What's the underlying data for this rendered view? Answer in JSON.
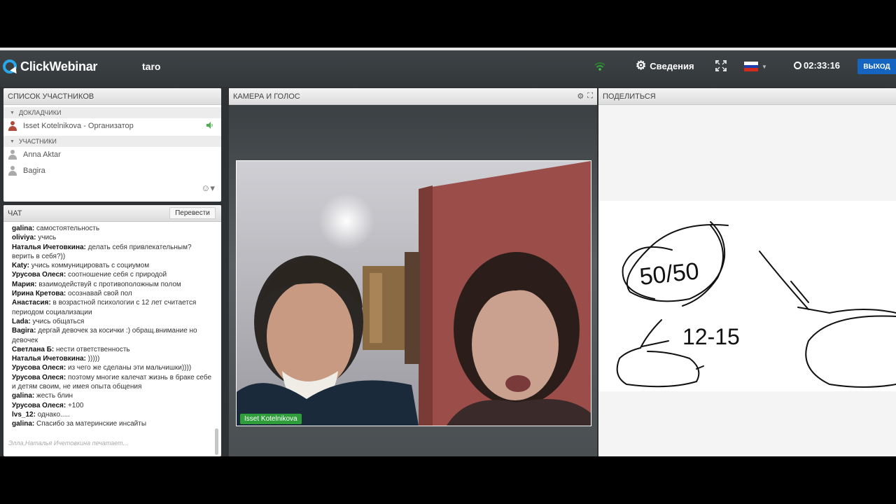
{
  "app": {
    "logo_text": "ClickWebinar",
    "room_name": "taro"
  },
  "header": {
    "info_label": "Сведения",
    "timer": "02:33:16",
    "exit_label": "ВЫХОД",
    "flag": "ru",
    "colors": {
      "accent": "#1565c0",
      "brand": "#2aa7e8"
    }
  },
  "participants": {
    "title": "СПИСОК УЧАСТНИКОВ",
    "speakers_label": "ДОКЛАДЧИКИ",
    "speakers": [
      {
        "name": "Isset Kotelnikova - Организатор"
      }
    ],
    "attendees_label": "УЧАСТНИКИ",
    "attendees": [
      {
        "name": "Anna Aktar"
      },
      {
        "name": "Bagira"
      }
    ]
  },
  "chat": {
    "title": "ЧАТ",
    "translate_label": "Перевести",
    "messages": [
      {
        "author": "galina:",
        "text": "самостоятельность"
      },
      {
        "author": "oliviya:",
        "text": "учись"
      },
      {
        "author": "Наталья Ичетовкина:",
        "text": "делать себя привлекательным? верить в себя?))"
      },
      {
        "author": "Katy:",
        "text": "учись коммуницировать с социумом"
      },
      {
        "author": "Урусова Олеся:",
        "text": "соотношение себя с природой"
      },
      {
        "author": "Мария:",
        "text": "взаимодействуй с противоположным полом"
      },
      {
        "author": "Ирина Кретова:",
        "text": "осознавай свой пол"
      },
      {
        "author": "Анастасия:",
        "text": "в возрастной психологии с 12 лет считается периодом социализации"
      },
      {
        "author": "Lada:",
        "text": "учись общаться"
      },
      {
        "author": "Bagira:",
        "text": "дергай девочек за косички :) обращ.внимание но девочек"
      },
      {
        "author": "Светлана Б:",
        "text": "нести ответственность"
      },
      {
        "author": "Наталья Ичетовкина:",
        "text": ")))))"
      },
      {
        "author": "Урусова Олеся:",
        "text": "из чего же сделаны эти мальчишки))))"
      },
      {
        "author": "Урусова Олеся:",
        "text": "поэтому многие калечат жизнь в браке себе и детям своим, не имея опыта общения"
      },
      {
        "author": "galina:",
        "text": "жесть блин"
      },
      {
        "author": "Урусова Олеся:",
        "text": "+100"
      },
      {
        "author": "lvs_12:",
        "text": "однако....."
      },
      {
        "author": "galina:",
        "text": "Спасибо за материнские инсайты"
      }
    ],
    "typing": "Элла,Наталья Ичетовкина печатает..."
  },
  "camera": {
    "title": "КАМЕРА И ГОЛОС",
    "presenter_tag": "Isset Kotelnikova"
  },
  "share": {
    "title": "ПОДЕЛИТЬСЯ",
    "whiteboard": {
      "top_left": "50/50",
      "middle": "12-15"
    }
  }
}
